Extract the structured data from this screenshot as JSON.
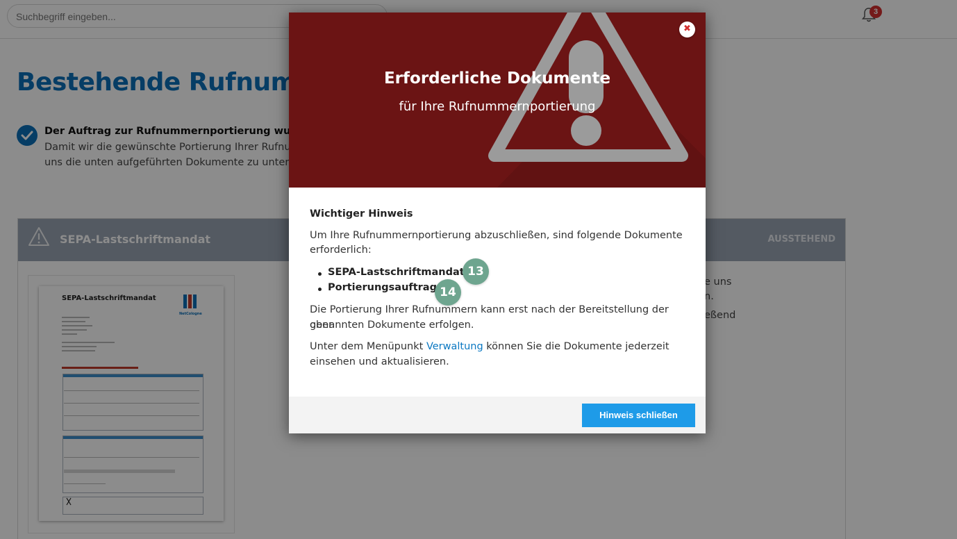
{
  "topbar": {
    "search_placeholder": "Suchbegriff eingeben...",
    "notification_count": "3"
  },
  "page": {
    "title": "Bestehende Rufnummer",
    "notice_title": "Der Auftrag zur Rufnummernportierung wurde erfo",
    "notice_line1": "Damit wir die gewünschte Portierung Ihrer Rufnumm",
    "notice_line2": "uns die unten aufgeführten Dokumente zu untersch"
  },
  "document_card": {
    "title": "SEPA-Lastschriftmandat",
    "status": "AUSSTEHEND",
    "side_line1": "e uns",
    "side_line2": "n.",
    "side_line3": "eßend",
    "thumbnail_title": "SEPA-Lastschriftmandat",
    "thumbnail_logo_text": "NetCologne"
  },
  "modal": {
    "title": "Erforderliche Dokumente",
    "subtitle": "für Ihre Rufnummernportierung",
    "close_symbol": "✖",
    "heading": "Wichtiger Hinweis",
    "intro_line1": "Um Ihre Rufnummernportierung abzuschließen, sind folgende Dokumente",
    "intro_line2": "erforderlich:",
    "items": [
      {
        "label": "SEPA-Lastschriftmandat",
        "badge": "13"
      },
      {
        "label": "Portierungsauftrag",
        "badge": "14"
      }
    ],
    "para2_line1": "Die Portierung Ihrer Rufnummern kann erst nach der Bereitstellung der oben",
    "para2_line2": "genannten Dokumente erfolgen.",
    "para3_pre": "Unter dem Menüpunkt ",
    "para3_link": "Verwaltung",
    "para3_post": " können Sie die Dokumente jederzeit",
    "para3_line2": "einsehen und aktualisieren.",
    "button_label": "Hinweis schließen"
  },
  "colors": {
    "brand_blue": "#0b6fb8",
    "hero_red": "#6b1414",
    "button_blue": "#1e9be8",
    "badge_green": "#6ea58f",
    "status_gray": "#9aa4b2"
  }
}
